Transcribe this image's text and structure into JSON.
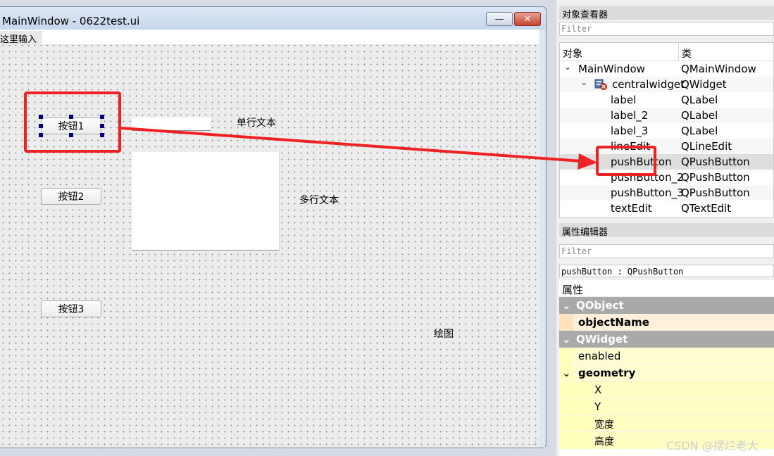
{
  "designer": {
    "window_title": "MainWindow - 0622test.ui",
    "minimize_glyph": "—",
    "close_glyph": "✕",
    "menu_placeholder": "这里输入",
    "buttons": [
      "按钮1",
      "按钮2",
      "按钮3"
    ],
    "labels": {
      "single_line": "单行文本",
      "multi_line": "多行文本",
      "drawing": "绘图"
    },
    "resize_grip": "⋰"
  },
  "object_inspector": {
    "title": "对象查看器",
    "filter_placeholder": "Filter",
    "columns": [
      "对象",
      "类"
    ],
    "rows": [
      {
        "object": "MainWindow",
        "class": "QMainWindow"
      },
      {
        "object": "centralwidget",
        "class": "QWidget"
      },
      {
        "object": "label",
        "class": "QLabel"
      },
      {
        "object": "label_2",
        "class": "QLabel"
      },
      {
        "object": "label_3",
        "class": "QLabel"
      },
      {
        "object": "lineEdit",
        "class": "QLineEdit"
      },
      {
        "object": "pushButton",
        "class": "QPushButton"
      },
      {
        "object": "pushButton_2",
        "class": "QPushButton"
      },
      {
        "object": "pushButton_3",
        "class": "QPushButton"
      },
      {
        "object": "textEdit",
        "class": "QTextEdit"
      }
    ],
    "selected_row": "pushButton",
    "expand_glyph": "⌄"
  },
  "property_editor": {
    "title": "属性编辑器",
    "filter_placeholder": "Filter",
    "current_object": "pushButton : QPushButton",
    "column": "属性",
    "rows": [
      {
        "name": "QObject",
        "kind": "group"
      },
      {
        "name": "objectName",
        "kind": "prop-bold"
      },
      {
        "name": "QWidget",
        "kind": "group"
      },
      {
        "name": "enabled",
        "kind": "prop"
      },
      {
        "name": "geometry",
        "kind": "prop-expand"
      },
      {
        "name": "X",
        "kind": "sub"
      },
      {
        "name": "Y",
        "kind": "sub"
      },
      {
        "name": "宽度",
        "kind": "sub"
      },
      {
        "name": "高度",
        "kind": "sub"
      }
    ]
  },
  "watermark": "CSDN @摆烂老大",
  "colors": {
    "annotation_red": "#ee2222",
    "selection_handle": "#000080",
    "group_header": "#a9a9a9",
    "property_yellow": "#ffffd2"
  }
}
